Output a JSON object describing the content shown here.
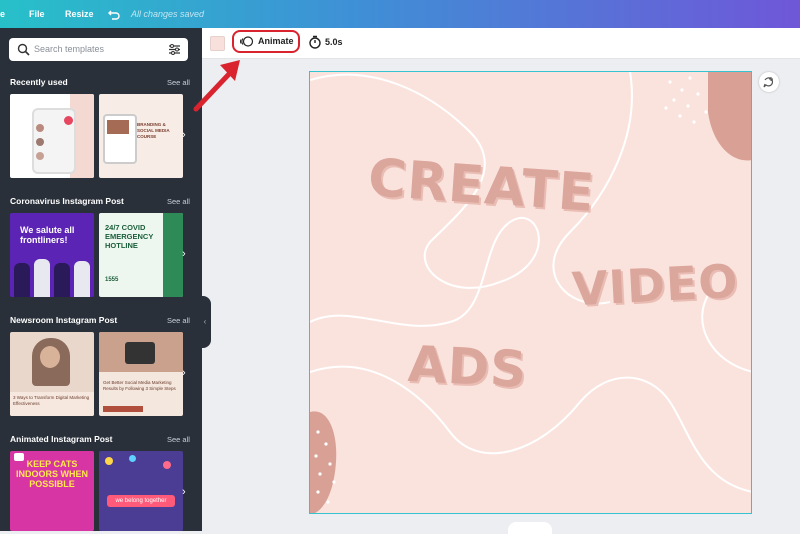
{
  "topbar": {
    "home_fragment": "e",
    "file": "File",
    "resize": "Resize",
    "undo_icon": "undo-icon",
    "saved_status": "All changes saved"
  },
  "sidebar": {
    "search_placeholder": "Search templates",
    "sections": [
      {
        "title": "Recently used",
        "see_all": "See all"
      },
      {
        "title": "Coronavirus Instagram Post",
        "see_all": "See all"
      },
      {
        "title": "Newsroom Instagram Post",
        "see_all": "See all"
      },
      {
        "title": "Animated Instagram Post",
        "see_all": "See all"
      }
    ],
    "thumbs": {
      "t1b_title": "BRANDING & SOCIAL MEDIA COURSE",
      "t2a_text": "We salute all frontliners!",
      "t2b_title": "24/7 COVID EMERGENCY HOTLINE",
      "t2b_num": "1555",
      "t3a_caption": "3 Ways to Transform Digital Marketing Effectiveness",
      "t3b_caption": "Get Better Social Media Marketing Results by Following 3 Simple Steps",
      "t4a_text": "KEEP CATS INDOORS WHEN POSSIBLE",
      "t4b_text": "we belong together"
    }
  },
  "toolbar": {
    "animate_label": "Animate",
    "duration": "5.0s"
  },
  "canvas": {
    "word1": "CREATE",
    "word2": "VIDEO",
    "word3": "ADS"
  },
  "colors": {
    "annotation_red": "#d9232f",
    "canvas_bg": "#fbe3dd",
    "text_pink": "#dba69c",
    "blob": "#d9a195"
  }
}
